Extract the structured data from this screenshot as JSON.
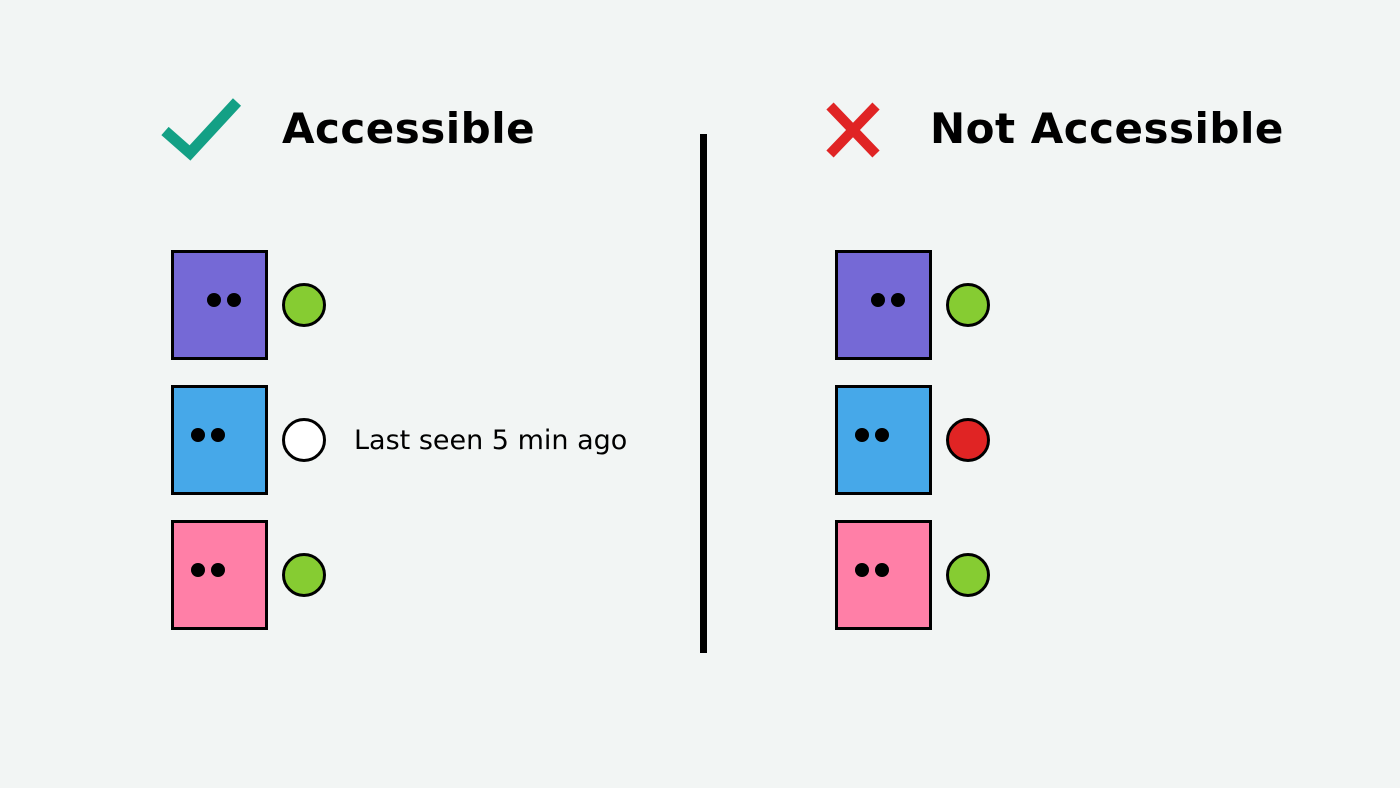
{
  "left_panel": {
    "heading": "Accessible",
    "icon": "checkmark-icon",
    "icon_color": "#13a085",
    "users": [
      {
        "avatar_color": "#7569d6",
        "status": "online",
        "status_color": "#86cc32",
        "status_text": ""
      },
      {
        "avatar_color": "#46a8e9",
        "status": "offline",
        "status_color": "#ffffff",
        "status_text": "Last seen 5 min ago"
      },
      {
        "avatar_color": "#ff7fa7",
        "status": "online",
        "status_color": "#86cc32",
        "status_text": ""
      }
    ]
  },
  "right_panel": {
    "heading": "Not Accessible",
    "icon": "cross-icon",
    "icon_color": "#e02424",
    "users": [
      {
        "avatar_color": "#7569d6",
        "status": "online",
        "status_color": "#86cc32",
        "status_text": ""
      },
      {
        "avatar_color": "#46a8e9",
        "status": "offline",
        "status_color": "#e02424",
        "status_text": ""
      },
      {
        "avatar_color": "#ff7fa7",
        "status": "online",
        "status_color": "#86cc32",
        "status_text": ""
      }
    ]
  }
}
